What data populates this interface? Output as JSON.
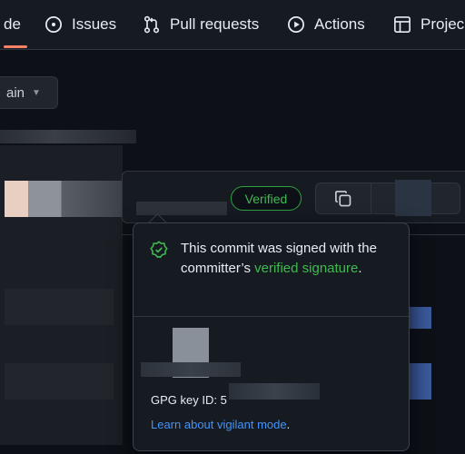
{
  "tabs": [
    {
      "label": "de",
      "icon": "code-icon",
      "active": true
    },
    {
      "label": "Issues",
      "icon": "issue-opened-icon",
      "active": false
    },
    {
      "label": "Pull requests",
      "icon": "git-pull-request-icon",
      "active": false
    },
    {
      "label": "Actions",
      "icon": "play-icon",
      "active": false
    },
    {
      "label": "Projec",
      "icon": "table-icon",
      "active": false
    }
  ],
  "branch": {
    "label": "ain",
    "icon": "triangle-down-icon"
  },
  "commit": {
    "verified_badge": "Verified",
    "copy_icon": "copy-icon"
  },
  "popover": {
    "message_prefix": "This commit was signed with the committer’s ",
    "message_link": "verified signature",
    "message_suffix": ".",
    "gpg_label": "GPG key ID: ",
    "gpg_value_partial": "5",
    "learn_link": "Learn about vigilant mode",
    "learn_suffix": "."
  },
  "colors": {
    "accent_green": "#3fb950",
    "link_blue": "#4493f8",
    "tab_underline": "#f78166",
    "background": "#0d1117"
  }
}
